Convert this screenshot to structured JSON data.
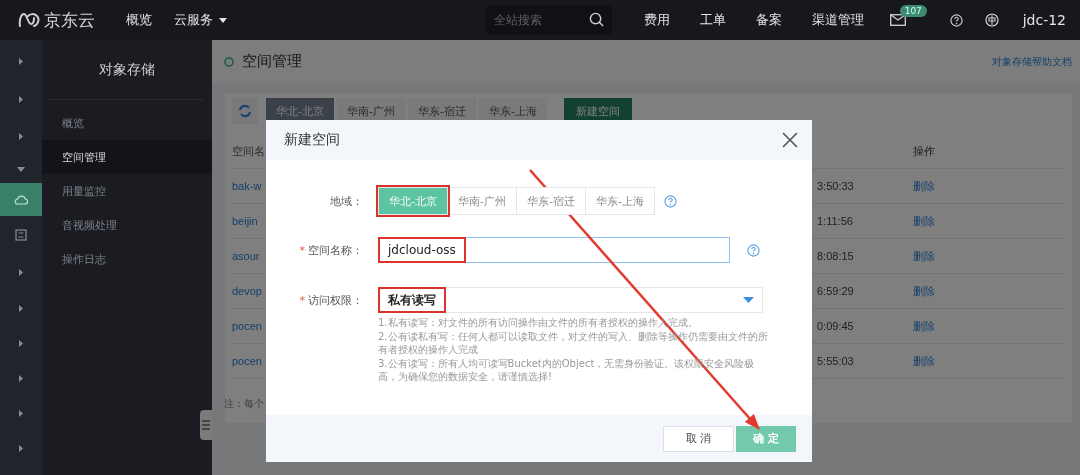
{
  "topbar": {
    "brand": "京东云",
    "nav": [
      {
        "label": "概览",
        "dropdown": false
      },
      {
        "label": "云服务",
        "dropdown": true
      }
    ],
    "search": {
      "placeholder": "全站搜索"
    },
    "links": [
      "费用",
      "工单",
      "备案",
      "渠道管理"
    ],
    "mail_badge": "107",
    "user": "jdc-12"
  },
  "rail": [
    {
      "kind": "caret"
    },
    {
      "kind": "caret"
    },
    {
      "kind": "caret"
    },
    {
      "kind": "caret-down"
    },
    {
      "kind": "cloud",
      "selected": true
    },
    {
      "kind": "box",
      "selected": false
    },
    {
      "kind": "caret"
    },
    {
      "kind": "caret"
    },
    {
      "kind": "caret"
    },
    {
      "kind": "caret"
    },
    {
      "kind": "caret"
    },
    {
      "kind": "caret"
    }
  ],
  "sidebar": {
    "title": "对象存储",
    "items": [
      {
        "label": "概览",
        "selected": false
      },
      {
        "label": "空间管理",
        "selected": true
      },
      {
        "label": "用量监控",
        "selected": false
      },
      {
        "label": "音视频处理",
        "selected": false
      },
      {
        "label": "操作日志",
        "selected": false
      }
    ]
  },
  "page": {
    "title": "空间管理",
    "help_link": "对象存储帮助文档",
    "region_tabs": [
      {
        "label": "华北-北京",
        "selected": true
      },
      {
        "label": "华南-广州",
        "selected": false
      },
      {
        "label": "华东-宿迁",
        "selected": false
      },
      {
        "label": "华东-上海",
        "selected": false
      }
    ],
    "new_button": "新建空间",
    "table": {
      "columns": [
        "空间名",
        "操作"
      ],
      "rows": [
        {
          "name": "bak-w",
          "time": "3:50:33",
          "action": "删除"
        },
        {
          "name": "beijin",
          "time": "1:11:56",
          "action": "删除"
        },
        {
          "name": "asour",
          "time": "8:08:15",
          "action": "删除"
        },
        {
          "name": "devop",
          "time": "6:59:29",
          "action": "删除"
        },
        {
          "name": "pocen",
          "time": "0:09:45",
          "action": "删除"
        },
        {
          "name": "pocen",
          "time": "5:55:03",
          "action": "删除"
        }
      ]
    },
    "note": "注：每个"
  },
  "dialog": {
    "title": "新建空间",
    "region": {
      "label": "地域：",
      "options": [
        {
          "label": "华北-北京",
          "selected": true,
          "highlighted": true
        },
        {
          "label": "华南-广州",
          "selected": false,
          "highlighted": false
        },
        {
          "label": "华东-宿迁",
          "selected": false,
          "highlighted": false
        },
        {
          "label": "华东-上海",
          "selected": false,
          "highlighted": false
        }
      ]
    },
    "name": {
      "label": "空间名称：",
      "required_mark": "*",
      "value": "jdcloud-oss",
      "highlighted": true
    },
    "access": {
      "label": "访问权限：",
      "required_mark": "*",
      "value": "私有读写",
      "highlighted": true,
      "help": [
        "1.私有读写：对文件的所有访问操作由文件的所有者授权的操作人完成。",
        "2.公有读私有写：任何人都可以读取文件，对文件的写入、删除等操作仍需要由文件的所有者授权的操作人完成",
        "3.公有读写：所有人均可读写Bucket内的Object，无需身份验证。该权限安全风险极高，为确保您的数据安全，请谨慎选择!"
      ]
    },
    "buttons": [
      {
        "label": "取 消",
        "kind": "secondary"
      },
      {
        "label": "确 定",
        "kind": "primary"
      }
    ]
  }
}
